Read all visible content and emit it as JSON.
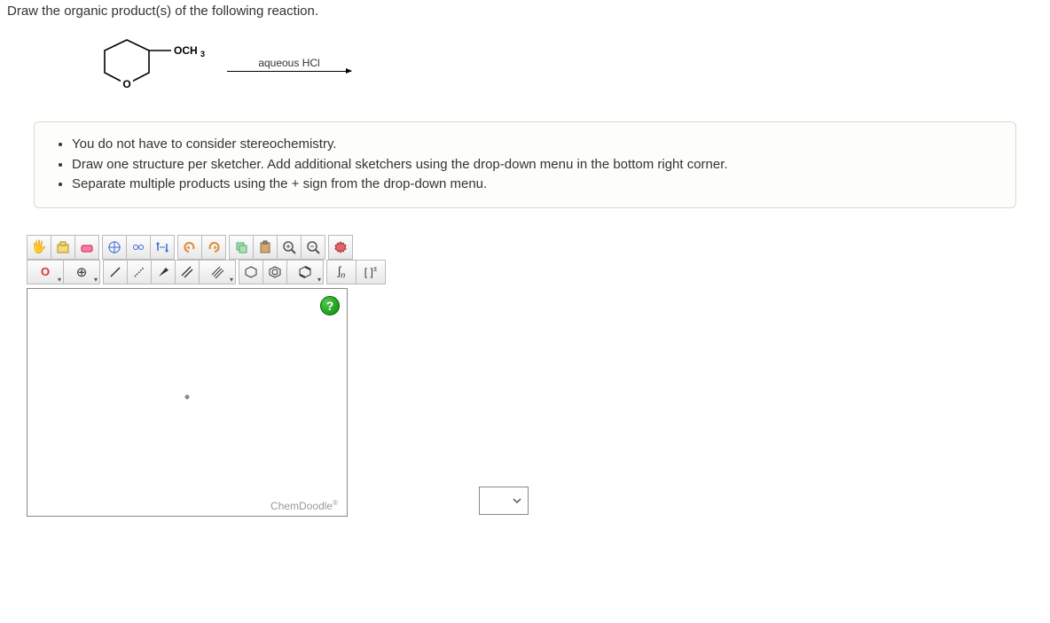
{
  "question": {
    "title": "Draw the organic product(s) of the following reaction.",
    "reaction": {
      "reactant_label": "OCH₃",
      "reagent": "aqueous HCl"
    }
  },
  "instructions": {
    "items": [
      "You do not have to consider stereochemistry.",
      "Draw one structure per sketcher. Add additional sketchers using the drop-down menu in the bottom right corner.",
      "Separate multiple products using the + sign from the drop-down menu."
    ]
  },
  "toolbar": {
    "row1": {
      "hand": "✋",
      "open": "open",
      "erase": "erase",
      "center": "center",
      "clean": "clean",
      "flip": "flip",
      "undo": "undo",
      "redo": "redo",
      "copy": "copy",
      "paste": "paste",
      "zoom_in": "+",
      "zoom_out": "−",
      "settings": "settings"
    },
    "row2": {
      "element": "O",
      "charge": "⊕",
      "single": "/",
      "recessed": "⋰",
      "wedge": "▰",
      "double": "//",
      "triple": "///",
      "ring1": "ring",
      "ring2": "ring-o",
      "ring3": "ring-b",
      "curve": "∫n",
      "bracket": "[ ]±"
    }
  },
  "canvas": {
    "help": "?",
    "brand": "ChemDoodle"
  }
}
